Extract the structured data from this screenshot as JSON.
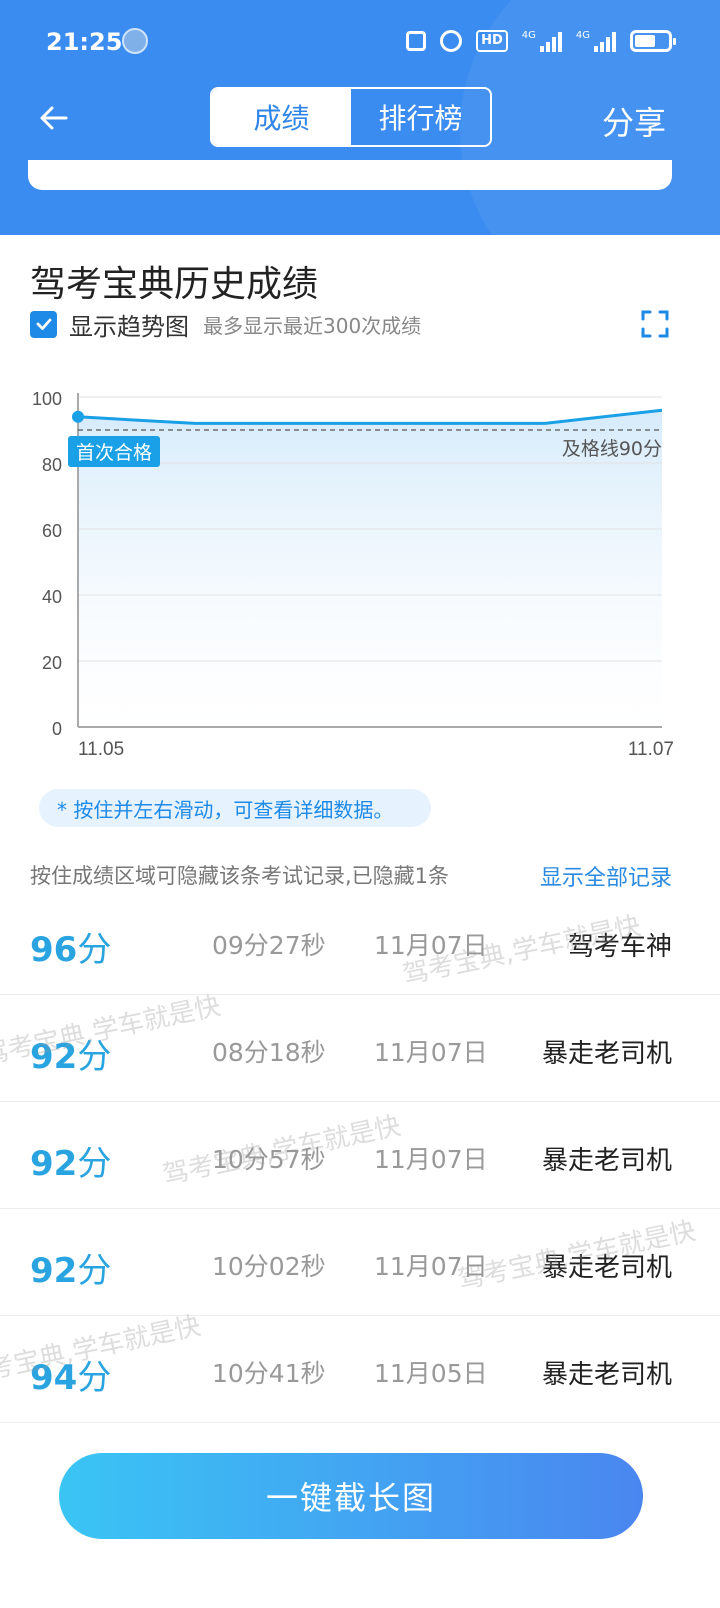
{
  "status_bar": {
    "time": "21:25"
  },
  "header": {
    "tabs": [
      {
        "label": "成绩",
        "active": true
      },
      {
        "label": "排行榜",
        "active": false
      }
    ],
    "share_label": "分享",
    "accent_color": "#3a8cf0"
  },
  "history": {
    "title": "驾考宝典历史成绩",
    "show_trend_label": "显示趋势图",
    "show_trend_checked": true,
    "trend_hint": "最多显示最近300次成绩"
  },
  "chart_data": {
    "type": "line",
    "x": [
      "11.05",
      "11.07"
    ],
    "series": [
      {
        "values": [
          94,
          92,
          92,
          92,
          92,
          96
        ]
      }
    ],
    "yticks": [
      0,
      20,
      40,
      60,
      80,
      100
    ],
    "ylim": [
      0,
      100
    ],
    "xtick_labels": [
      "11.05",
      "11.07"
    ],
    "pass_line": {
      "value": 90,
      "label": "及格线90分"
    },
    "first_pass_label": "首次合格",
    "grid": true
  },
  "tip": "* 按住并左右滑动，可查看详细数据。",
  "records": {
    "hide_note": "按住成绩区域可隐藏该条考试记录,已隐藏1条",
    "show_all_label": "显示全部记录",
    "score_unit": "分",
    "rows": [
      {
        "score": "96",
        "duration": "09分27秒",
        "date": "11月07日",
        "title": "驾考车神"
      },
      {
        "score": "92",
        "duration": "08分18秒",
        "date": "11月07日",
        "title": "暴走老司机"
      },
      {
        "score": "92",
        "duration": "10分57秒",
        "date": "11月07日",
        "title": "暴走老司机"
      },
      {
        "score": "92",
        "duration": "10分02秒",
        "date": "11月07日",
        "title": "暴走老司机"
      },
      {
        "score": "94",
        "duration": "10分41秒",
        "date": "11月05日",
        "title": "暴走老司机"
      }
    ]
  },
  "watermark_text": "驾考宝典,学车就是快",
  "cta_label": "一键截长图"
}
